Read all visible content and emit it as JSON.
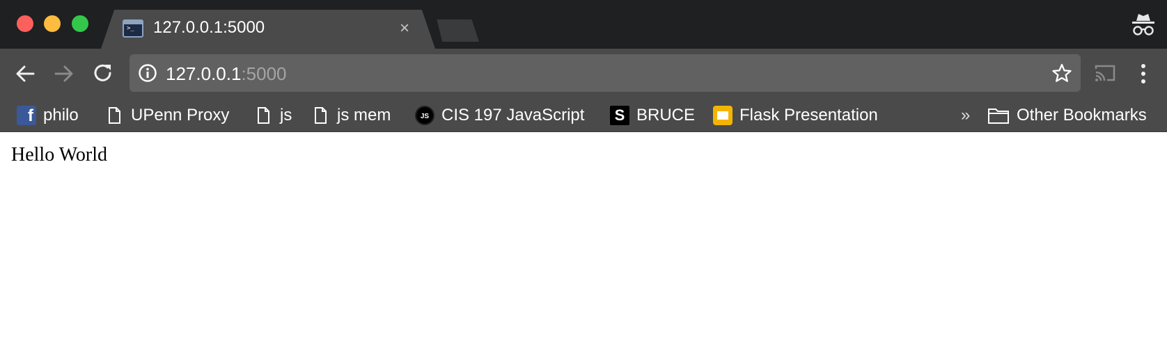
{
  "tab": {
    "title": "127.0.0.1:5000",
    "favicon_glyph": ">_",
    "close_glyph": "×"
  },
  "omnibox": {
    "host": "127.0.0.1",
    "port": ":5000"
  },
  "bookmarks": [
    {
      "label": "philo",
      "icon": "facebook-icon",
      "glyph": "f"
    },
    {
      "label": "UPenn Proxy",
      "icon": "page-icon"
    },
    {
      "label": "js",
      "icon": "page-icon"
    },
    {
      "label": "js mem",
      "icon": "page-icon"
    },
    {
      "label": "CIS 197 JavaScript",
      "icon": "js-logo-icon",
      "glyph": "JS"
    },
    {
      "label": "BRUCE",
      "icon": "s-logo-icon",
      "glyph": "S"
    },
    {
      "label": "Flask Presentation",
      "icon": "google-slides-icon"
    }
  ],
  "bookmarks_overflow": "»",
  "other_bookmarks": {
    "label": "Other Bookmarks",
    "icon": "folder-icon"
  },
  "page": {
    "text": "Hello World"
  },
  "colors": {
    "tabstrip": "#1f2021",
    "toolbar": "#4a4a4b",
    "omnibox": "#616161",
    "close": "#fc605c",
    "minimize": "#fdbc40",
    "maximize": "#34c84a"
  }
}
